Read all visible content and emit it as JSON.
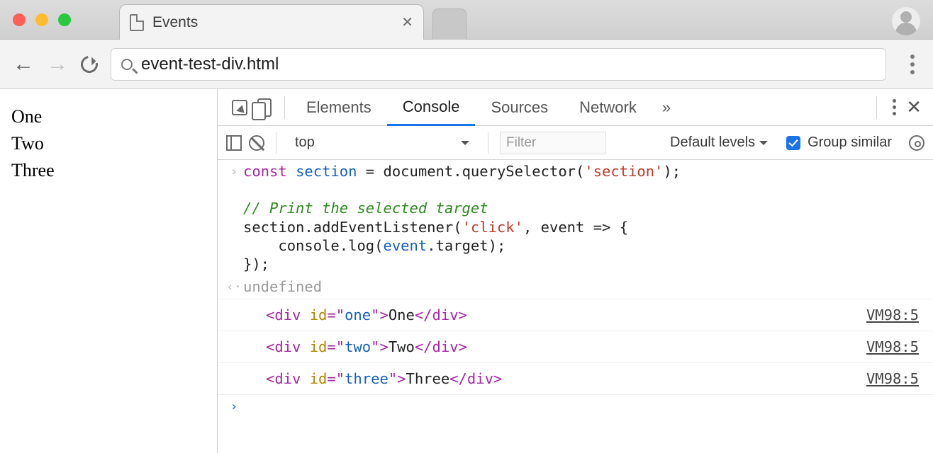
{
  "browser": {
    "tab_title": "Events",
    "url": "event-test-div.html"
  },
  "page": {
    "items": [
      "One",
      "Two",
      "Three"
    ]
  },
  "devtools": {
    "tabs": {
      "t0": "Elements",
      "t1": "Console",
      "t2": "Sources",
      "t3": "Network"
    },
    "more_glyph": "»",
    "context": "top",
    "filter_placeholder": "Filter",
    "levels_label": "Default levels",
    "group_similar_label": "Group similar"
  },
  "console": {
    "input": {
      "l1a": "const",
      "l1b": "section",
      "l1c": " = document.querySelector(",
      "l1d": "'section'",
      "l1e": ");",
      "blank": "",
      "l2": "// Print the selected target",
      "l3a": "section.addEventListener(",
      "l3b": "'click'",
      "l3c": ", event => {",
      "l4a": "    console.log(",
      "l4b": "event",
      "l4c": ".target);",
      "l5": "});"
    },
    "result": "undefined",
    "logs": [
      {
        "tag_open": "<div",
        "attr": " id",
        "eq": "=\"",
        "val": "one",
        "q2": "\">",
        "text": "One",
        "close": "</div>",
        "src": "VM98:5"
      },
      {
        "tag_open": "<div",
        "attr": " id",
        "eq": "=\"",
        "val": "two",
        "q2": "\">",
        "text": "Two",
        "close": "</div>",
        "src": "VM98:5"
      },
      {
        "tag_open": "<div",
        "attr": " id",
        "eq": "=\"",
        "val": "three",
        "q2": "\">",
        "text": "Three",
        "close": "</div>",
        "src": "VM98:5"
      }
    ]
  }
}
